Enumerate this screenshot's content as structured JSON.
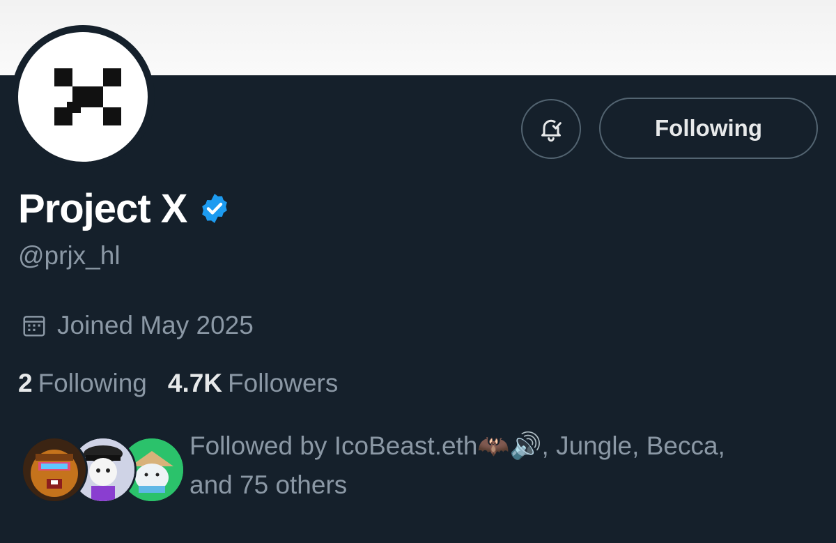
{
  "profile": {
    "name": "Project X",
    "handle": "@prjx_hl",
    "joined": "Joined May 2025",
    "verified": true,
    "avatar_icon": "pixel-x-logo"
  },
  "actions": {
    "notify_icon": "bell-check-icon",
    "follow_label": "Following"
  },
  "stats": {
    "following_count": "2",
    "following_label": "Following",
    "followers_count": "4.7K",
    "followers_label": "Followers"
  },
  "followed_by": {
    "prefix": "Followed by ",
    "first": "IcoBeast.eth",
    "emoji": "🦇🔊",
    "rest": ", Jungle, Becca,",
    "tail": "and 75 others"
  },
  "colors": {
    "background": "#15202b",
    "secondary_text": "#8b98a5",
    "verified_blue": "#1d9bf0",
    "border": "#536471"
  }
}
